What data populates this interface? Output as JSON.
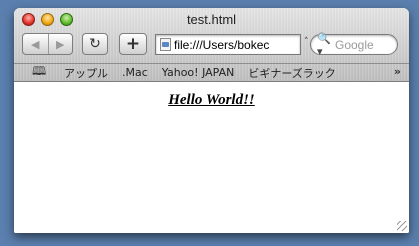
{
  "window": {
    "title": "test.html"
  },
  "toolbar": {
    "back_icon": "◀",
    "forward_icon": "▶",
    "reload_icon": "↻",
    "add_icon": "+",
    "url": "file:///Users/bokec",
    "search_placeholder": "Google",
    "search_icon": "🔍▾"
  },
  "bookmarks": {
    "book_icon": "🕮",
    "items": [
      "アップル",
      ".Mac",
      "Yahoo! JAPAN",
      "ビギナーズラック"
    ],
    "more_icon": "»"
  },
  "content": {
    "heading": "Hello World!!"
  }
}
